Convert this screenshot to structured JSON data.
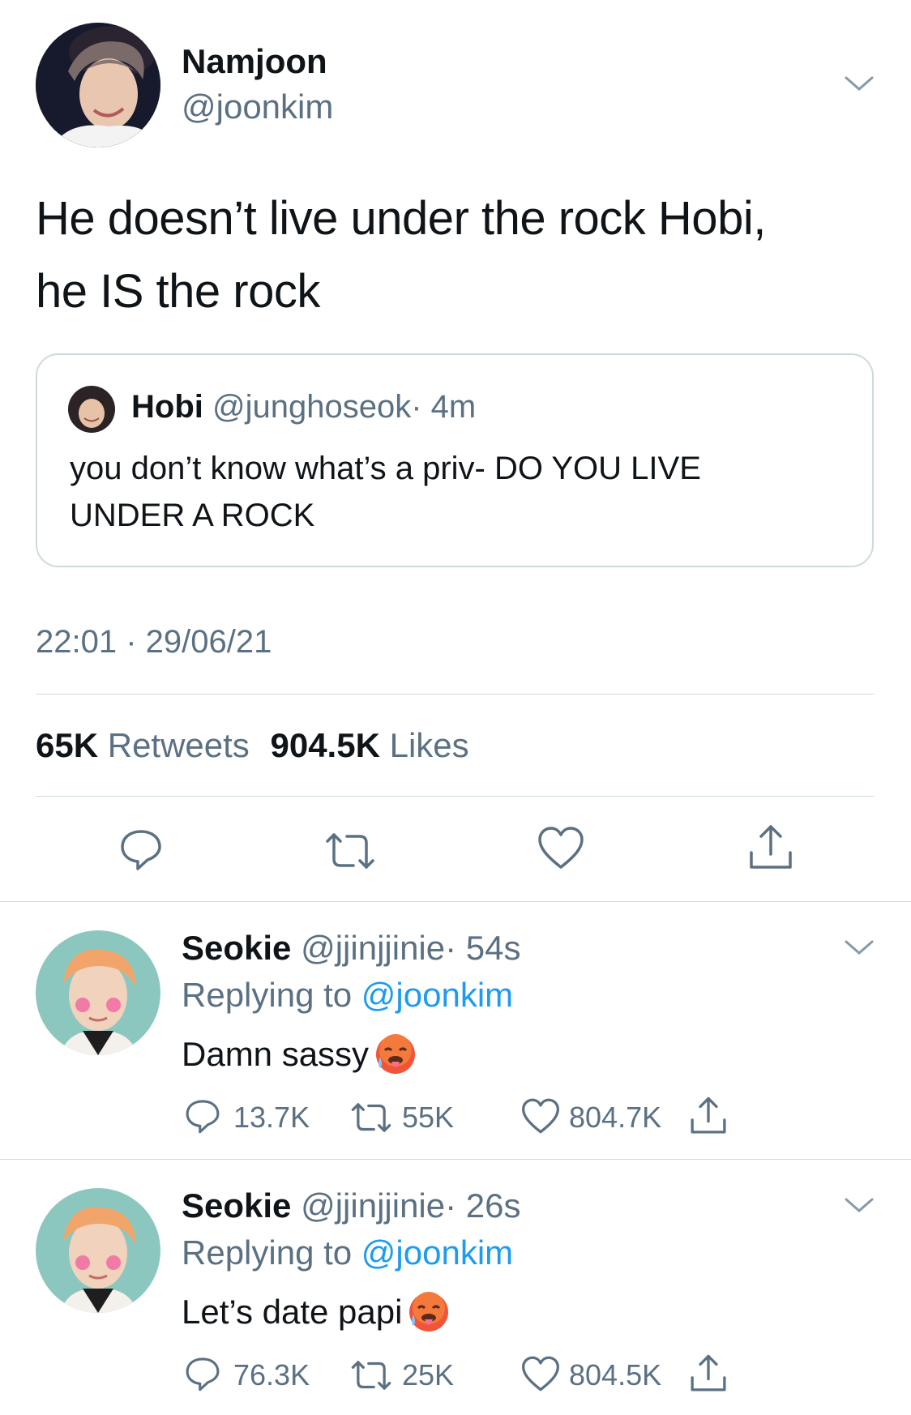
{
  "main_tweet": {
    "display_name": "Namjoon",
    "handle": "@joonkim",
    "text_line1": "He doesn’t live under the rock Hobi,",
    "text_line2": "he IS the rock",
    "timestamp": "22:01 · 29/06/21",
    "retweets_count": "65K",
    "retweets_label": "Retweets",
    "likes_count": "904.5K",
    "likes_label": "Likes",
    "quoted": {
      "display_name": "Hobi",
      "handle": "@junghoseok",
      "age": "· 4m",
      "text_line1": "you don’t know what’s a priv- DO YOU LIVE",
      "text_line2": "UNDER A ROCK"
    }
  },
  "replies": [
    {
      "display_name": "Seokie",
      "handle": "@jjinjjinie",
      "age": "· 54s",
      "replying_prefix": "Replying to",
      "replying_to": "@joonkim",
      "text": "Damn sassy",
      "emoji": "hot-face-drooling-emoji",
      "reply_count": "13.7K",
      "retweet_count": "55K",
      "like_count": "804.7K"
    },
    {
      "display_name": "Seokie",
      "handle": "@jjinjjinie",
      "age": "· 26s",
      "replying_prefix": "Replying to",
      "replying_to": "@joonkim",
      "text": "Let’s date papi",
      "emoji": "hot-face-drooling-emoji",
      "reply_count": "76.3K",
      "retweet_count": "25K",
      "like_count": "804.5K"
    }
  ],
  "colors": {
    "text": "#0f1419",
    "secondary": "#5b7083",
    "link": "#1d9bf0",
    "divider": "#cfd9de"
  }
}
